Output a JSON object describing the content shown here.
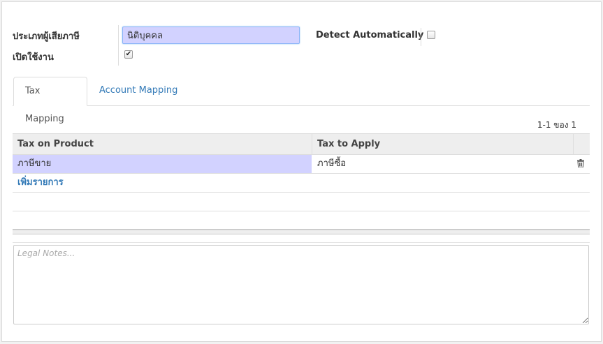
{
  "form": {
    "partner_type_label": "ประเภทผู้เสียภาษี",
    "name_value": "นิติบุคคล",
    "detect_label": "Detect Automatically",
    "detect_checked": false,
    "active_label": "เปิดใช้งาน",
    "active_checked": true
  },
  "tabs": [
    {
      "label": "Tax Mapping",
      "active": true
    },
    {
      "label": "Account Mapping",
      "active": false
    }
  ],
  "pager": "1-1 ของ 1",
  "table": {
    "columns": [
      "Tax on Product",
      "Tax to Apply"
    ],
    "rows": [
      {
        "tax_src": "ภาษีขาย",
        "tax_dest": "ภาษีซื้อ"
      }
    ],
    "add_label": "เพิ่มรายการ"
  },
  "notes": {
    "placeholder": "Legal Notes..."
  },
  "colors": {
    "accent_link": "#337ab7",
    "selected_row": "#d2d2ff"
  },
  "icons": {
    "delete": "trash-icon",
    "check": "checkmark"
  }
}
